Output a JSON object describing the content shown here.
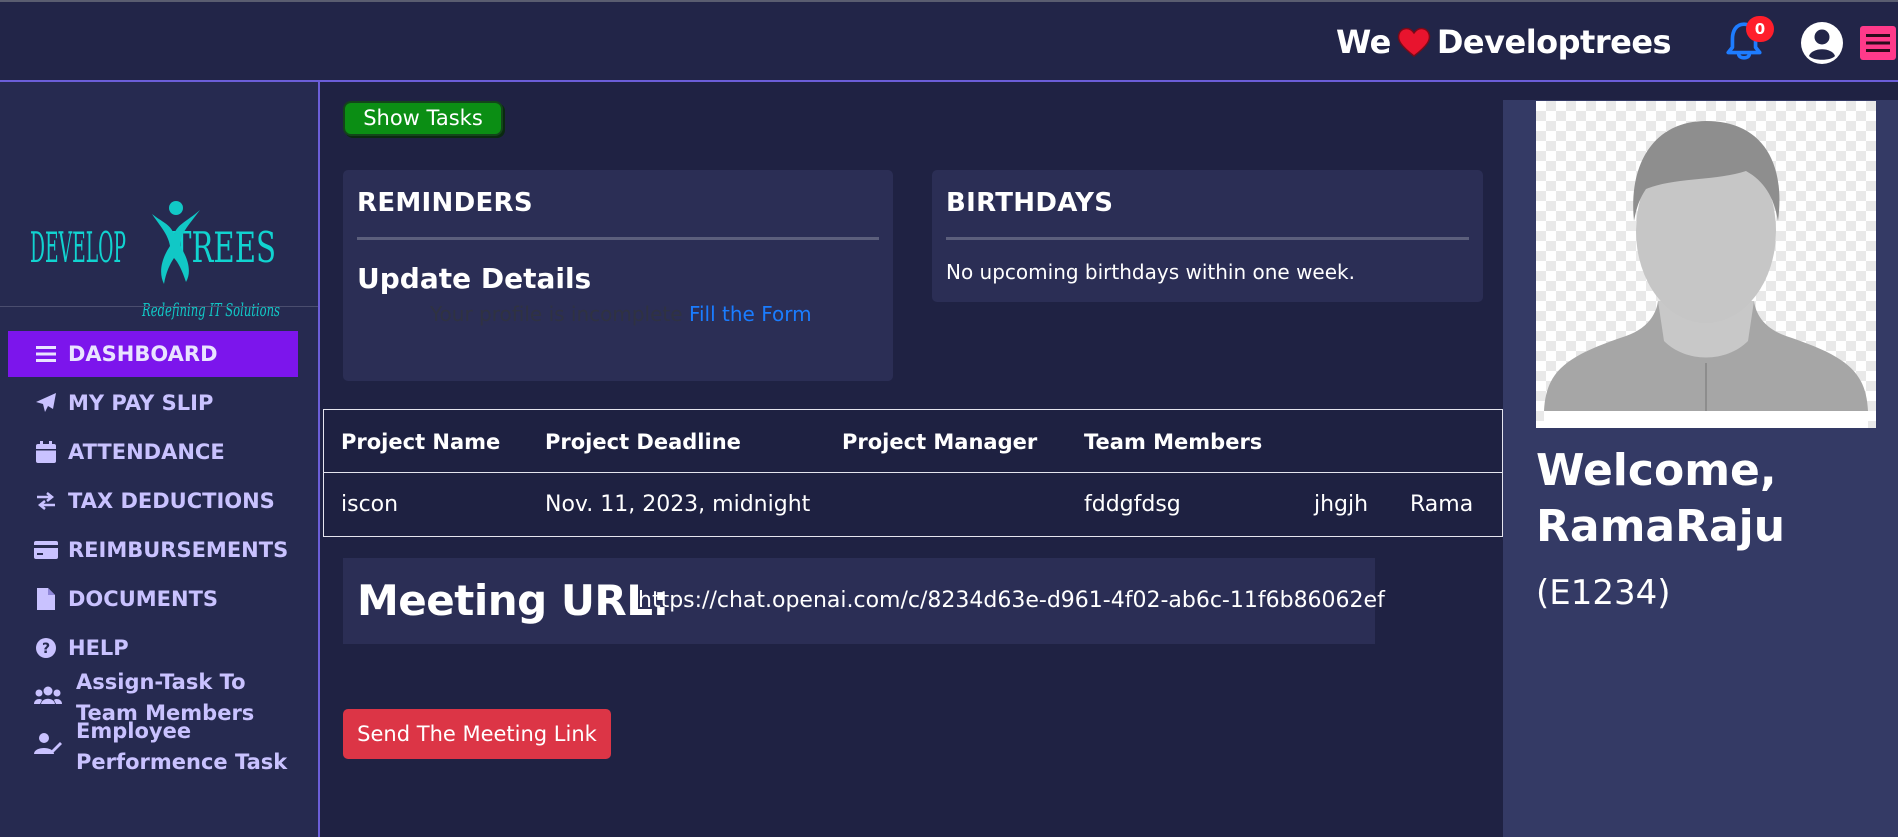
{
  "header": {
    "brand_prefix": "We",
    "brand_name": "Developtrees",
    "notification_count": "0"
  },
  "sidebar": {
    "logo": {
      "word_left": "DEVELOP",
      "word_right": "TREES",
      "tagline": "Redefining IT Solutions"
    },
    "items": [
      {
        "label": "DASHBOARD",
        "icon": "bars-icon",
        "active": true
      },
      {
        "label": "MY PAY SLIP",
        "icon": "paper-plane-icon"
      },
      {
        "label": "ATTENDANCE",
        "icon": "calendar-icon"
      },
      {
        "label": "TAX DEDUCTIONS",
        "icon": "exchange-icon"
      },
      {
        "label": "REIMBURSEMENTS",
        "icon": "credit-card-icon"
      },
      {
        "label": "DOCUMENTS",
        "icon": "file-icon"
      },
      {
        "label": "HELP",
        "icon": "question-circle-icon"
      }
    ],
    "assign_task": {
      "line1": "Assign-Task To",
      "line2": "Team Members",
      "icon": "users-icon"
    },
    "employee_perf": {
      "line1": "Employee",
      "line2": "Performence Task",
      "icon": "user-edit-icon"
    }
  },
  "main": {
    "show_tasks_label": "Show Tasks",
    "reminders": {
      "title": "REMINDERS",
      "subtitle": "Update Details",
      "text": "Your profile is incomplete",
      "link": "Fill the Form"
    },
    "birthdays": {
      "title": "BIRTHDAYS",
      "text": "No upcoming birthdays within one week."
    },
    "projects": {
      "headers": [
        "Project Name",
        "Project Deadline",
        "Project Manager",
        "Team Members"
      ],
      "rows": [
        {
          "name": "iscon",
          "deadline": "Nov. 11, 2023, midnight",
          "manager": "",
          "members": [
            "fddgfdsg",
            "jhgjh",
            "Rama"
          ]
        }
      ]
    },
    "meeting": {
      "label": "Meeting URL:",
      "url": "https://chat.openai.com/c/8234d63e-d961-4f02-ab6c-11f6b86062ef"
    },
    "send_label": "Send The Meeting Link"
  },
  "profile": {
    "welcome_line1": "Welcome,",
    "welcome_line2": "RamaRaju",
    "emp_id": "(E1234)"
  },
  "colors": {
    "accent_purple": "#7c15ec",
    "show_tasks_green": "#0b8e14",
    "send_button_red": "#dc3546",
    "link_blue": "#1a7cff",
    "menu_pink": "#ff3a8a"
  }
}
